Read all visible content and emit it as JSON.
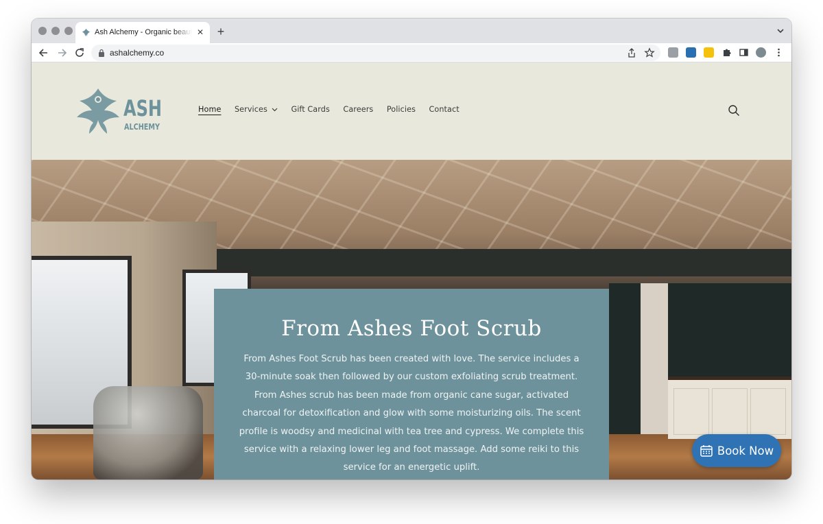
{
  "browser": {
    "tab_title": "Ash Alchemy - Organic beauty",
    "tab_close": "✕",
    "new_tab": "+",
    "url": "ashalchemy.co"
  },
  "site": {
    "logo_text_main": "ASH",
    "logo_text_sub": "ALCHEMY",
    "nav": {
      "home": "Home",
      "services": "Services",
      "gift_cards": "Gift Cards",
      "careers": "Careers",
      "policies": "Policies",
      "contact": "Contact"
    },
    "accent_color": "#6e929b",
    "header_bg": "#e8e9dc"
  },
  "hero": {
    "title": "From Ashes Foot Scrub",
    "body": "From Ashes Foot Scrub has been created with love. The service includes a 30-minute soak then followed by our custom exfoliating scrub treatment. From Ashes scrub has been made from organic cane sugar, activated charcoal for detoxification and glow with some moisturizing oils. The scent profile is woodsy and medicinal with tea tree and cypress. We complete this service with a relaxing lower leg and foot massage. Add some reiki to this service for an energetic uplift."
  },
  "booking": {
    "label": "Book Now",
    "color": "#2f73b5"
  },
  "icons": {
    "favicon": "phoenix-icon",
    "back": "arrow-left-icon",
    "forward": "arrow-right-icon",
    "reload": "reload-icon",
    "lock": "lock-icon",
    "share": "share-icon",
    "bookmark": "star-icon",
    "search": "search-icon",
    "calendar": "calendar-icon"
  }
}
